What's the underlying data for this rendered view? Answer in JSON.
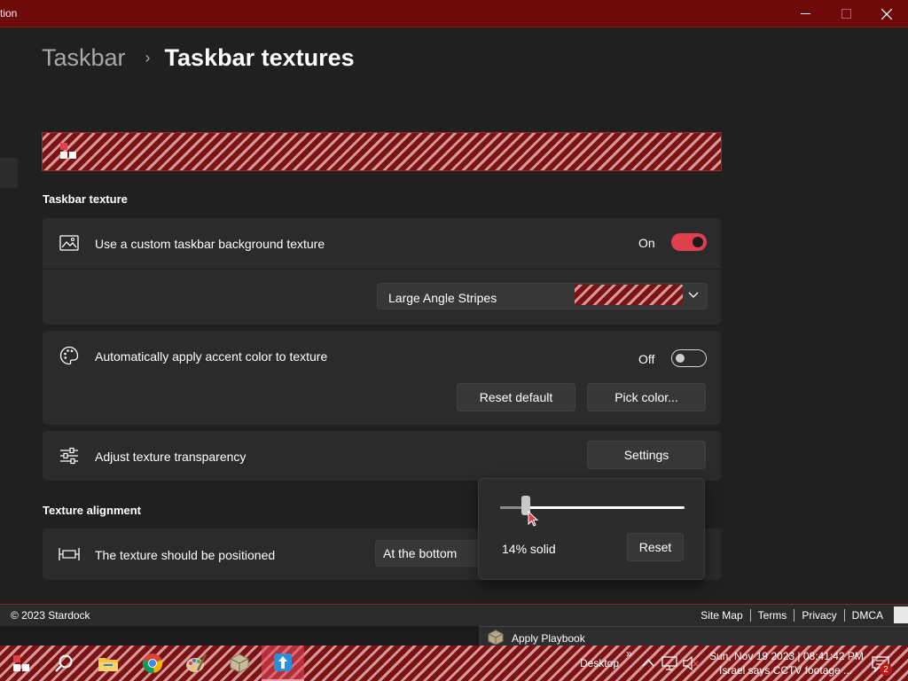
{
  "window": {
    "title": "tion",
    "controls": {
      "minimize": "minimize",
      "maximize": "maximize",
      "close": "close"
    }
  },
  "breadcrumb": {
    "parent": "Taskbar",
    "current": "Taskbar textures"
  },
  "accent": {
    "dark_red": "#7a1414",
    "light_stripe": "#d69898",
    "toggle_on": "#e0404e"
  },
  "texture_section": {
    "header": "Taskbar texture",
    "custom_bg": {
      "label": "Use a custom taskbar background texture",
      "state": "On",
      "icon": "image-icon"
    },
    "texture_dropdown": {
      "selected": "Large Angle Stripes"
    },
    "auto_accent": {
      "label": "Automatically apply accent color to texture",
      "state": "Off",
      "icon": "palette-icon",
      "reset_button": "Reset default",
      "pick_button": "Pick color..."
    },
    "transparency": {
      "label": "Adjust texture transparency",
      "icon": "sliders-icon",
      "settings_button": "Settings"
    }
  },
  "alignment_section": {
    "header": "Texture alignment",
    "position": {
      "label": "The texture should be positioned",
      "icon": "align-icon",
      "selected": "At the bottom"
    }
  },
  "transparency_flyout": {
    "value_fraction": 0.14,
    "value_text": "14% solid",
    "reset_button": "Reset"
  },
  "footer": {
    "copyright": "© 2023 Stardock",
    "links": [
      "Site Map",
      "Terms",
      "Privacy",
      "DMCA"
    ]
  },
  "playbook_tooltip": {
    "label": "Apply Playbook"
  },
  "taskbar": {
    "desktop_label": "Desktop",
    "overflow": "»",
    "clock_line1": "Sun, Nov 19 2023 | 08:41:42 PM",
    "clock_line2": "Israel says CCTV footage ...",
    "notification_count": "2",
    "apps": [
      "start-icon",
      "search-icon",
      "file-explorer-icon",
      "chrome-icon",
      "paint-icon",
      "package-icon",
      "start11-icon"
    ]
  }
}
